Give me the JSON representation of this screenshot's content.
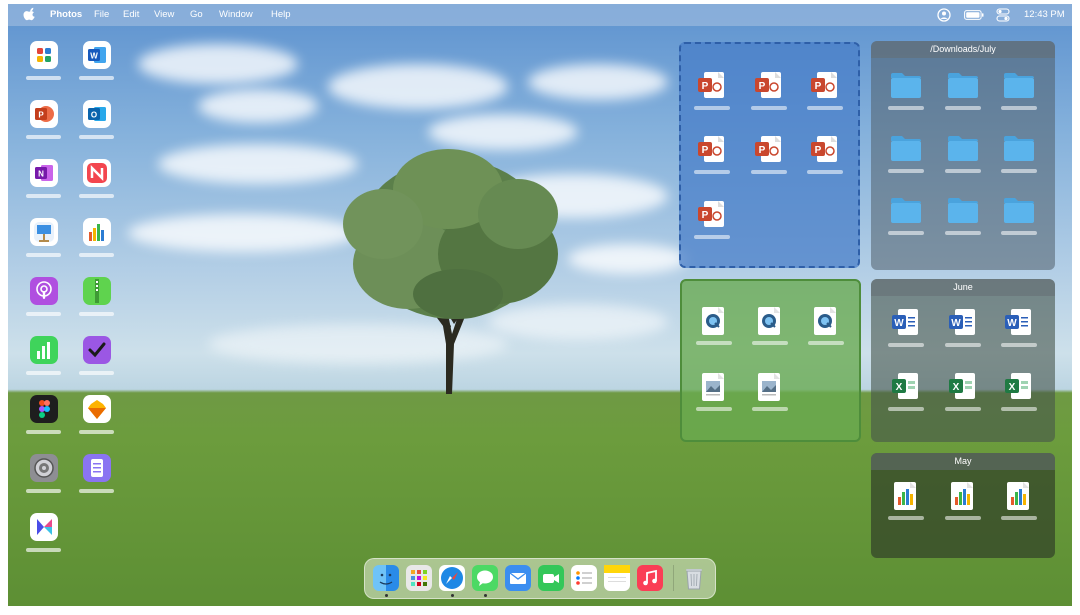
{
  "menubar": {
    "apple_icon": "apple-logo-icon",
    "app_name": "Photos",
    "menus": [
      "File",
      "Edit",
      "View",
      "Go",
      "Window",
      "Help"
    ],
    "status_icons": [
      "user-account-icon",
      "battery-icon",
      "control-center-icon"
    ],
    "clock": "12:43 PM"
  },
  "desktop_icons": [
    "microsoft-office-icon",
    "microsoft-word-icon",
    "microsoft-powerpoint-icon",
    "microsoft-outlook-icon",
    "microsoft-onenote-icon",
    "news-icon",
    "keynote-icon",
    "numbers-icon",
    "podcasts-icon",
    "archive-utility-icon",
    "numbers-chart-icon",
    "omnifocus-icon",
    "figma-icon",
    "sketch-icon",
    "system-preferences-icon",
    "notes-list-icon",
    "craft-icon"
  ],
  "stacks": {
    "powerpoint_stack": {
      "file_type": "powerpoint-file-icon",
      "count": 7
    },
    "preview_stack": {
      "file_types": [
        "quicktime-file-icon",
        "preview-file-icon"
      ],
      "count": 5
    },
    "downloads_july": {
      "title": "/Downloads/July",
      "file_type": "folder-icon",
      "count": 9
    },
    "june": {
      "title": "June",
      "file_types": [
        "word-file-icon",
        "excel-file-icon"
      ],
      "count": 6
    },
    "may": {
      "title": "May",
      "file_type": "numbers-file-icon",
      "count": 3
    }
  },
  "dock": {
    "apps": [
      "finder-icon",
      "launchpad-icon",
      "safari-icon",
      "messages-icon",
      "mail-icon",
      "facetime-icon",
      "reminders-icon",
      "notes-icon",
      "music-icon",
      "trash-icon"
    ]
  },
  "colors": {
    "powerpoint": "#c9472e",
    "word": "#2b5fb8",
    "excel": "#1f7a43",
    "folder": "#5bb4ec",
    "blue_stack": "#4b83cf",
    "green_stack": "#6aa84c"
  }
}
